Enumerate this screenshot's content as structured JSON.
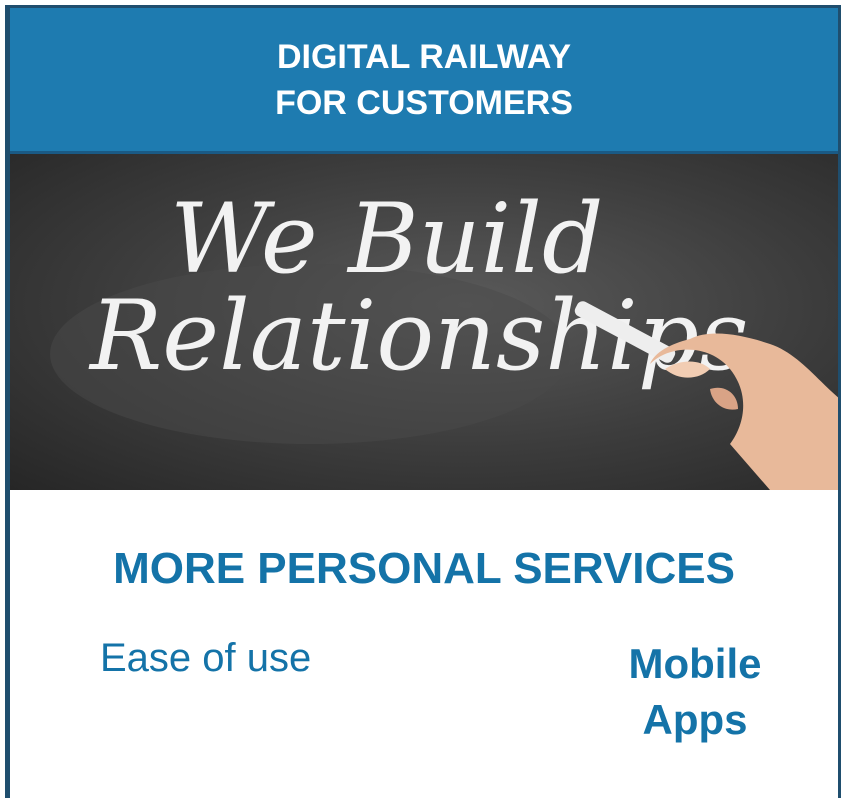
{
  "header": {
    "line1": "DIGITAL RAILWAY",
    "line2": "FOR  CUSTOMERS"
  },
  "photo": {
    "line1": "We Build",
    "line2": "Relationships"
  },
  "section": {
    "title": "MORE PERSONAL SERVICES"
  },
  "items": {
    "ease": "Ease of use",
    "mobile_line1": "Mobile",
    "mobile_line2": "Apps"
  },
  "colors": {
    "header_bg": "#1e7bb0",
    "accent_text": "#1473a8",
    "border": "#1f4e6e"
  }
}
